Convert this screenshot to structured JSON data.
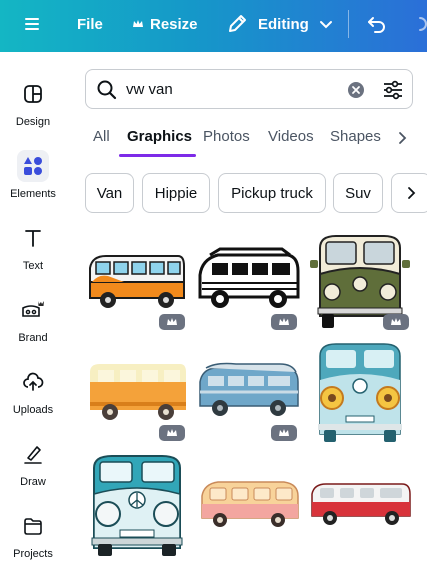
{
  "topbar": {
    "file": "File",
    "resize": "Resize",
    "editing": "Editing"
  },
  "sidebar": {
    "items": [
      {
        "label": "Design",
        "icon": "design-icon"
      },
      {
        "label": "Elements",
        "icon": "elements-icon"
      },
      {
        "label": "Text",
        "icon": "text-icon"
      },
      {
        "label": "Brand",
        "icon": "brand-icon"
      },
      {
        "label": "Uploads",
        "icon": "uploads-icon"
      },
      {
        "label": "Draw",
        "icon": "draw-icon"
      },
      {
        "label": "Projects",
        "icon": "projects-icon"
      }
    ]
  },
  "search": {
    "value": "vw van"
  },
  "tabs": [
    "All",
    "Graphics",
    "Photos",
    "Videos",
    "Shapes"
  ],
  "active_tab": "Graphics",
  "chips": [
    "Van",
    "Hippie",
    "Pickup truck",
    "Suv"
  ],
  "colors": {
    "accent": "#7d2ae8",
    "brand_gradient_start": "#14b6c4",
    "brand_gradient_end": "#2b6fd8"
  },
  "results": [
    {
      "name": "orange-white-bus-graphic",
      "premium": true
    },
    {
      "name": "black-white-bus-sketch",
      "premium": true
    },
    {
      "name": "green-bus-front-graphic",
      "premium": true
    },
    {
      "name": "orange-cream-van-graphic",
      "premium": true
    },
    {
      "name": "blue-watercolor-van-graphic",
      "premium": true
    },
    {
      "name": "teal-flower-bus-front",
      "premium": false
    },
    {
      "name": "teal-peace-bus-front",
      "premium": false
    },
    {
      "name": "peach-pink-van-graphic",
      "premium": false
    },
    {
      "name": "red-white-van-graphic",
      "premium": false
    }
  ]
}
